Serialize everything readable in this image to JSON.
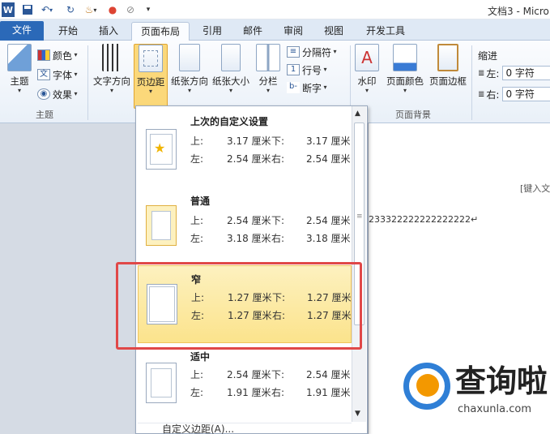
{
  "window": {
    "title": "文档3 - Micro"
  },
  "quick_access": {
    "icons": [
      "word-logo-icon",
      "save-icon",
      "undo-icon",
      "redo-icon",
      "format-painter-icon",
      "color-icon",
      "clear-format-icon",
      "customize-qat-icon"
    ]
  },
  "tabs": [
    {
      "label": "文件"
    },
    {
      "label": "开始"
    },
    {
      "label": "插入"
    },
    {
      "label": "页面布局"
    },
    {
      "label": "引用"
    },
    {
      "label": "邮件"
    },
    {
      "label": "审阅"
    },
    {
      "label": "视图"
    },
    {
      "label": "开发工具"
    }
  ],
  "ribbon": {
    "theme_group": {
      "label": "主题",
      "themes_btn": "主题",
      "colors_btn": "颜色",
      "fonts_btn": "字体",
      "effects_btn": "效果"
    },
    "page_setup": {
      "text_direction": "文字方向",
      "margins": "页边距",
      "orientation": "纸张方向",
      "size": "纸张大小",
      "columns": "分栏",
      "breaks": "分隔符",
      "line_numbers": "行号",
      "hyphenation": "断字"
    },
    "page_background": {
      "label": "页面背景",
      "watermark": "水印",
      "page_color": "页面颜色",
      "page_borders": "页面边框"
    },
    "indent": {
      "label": "缩进",
      "left_label": "左:",
      "left_value": "0 字符",
      "right_label": "右:",
      "right_value": "0 字符"
    }
  },
  "margins_menu": {
    "items": [
      {
        "name": "上次的自定义设置",
        "top_label": "上:",
        "top": "3.17 厘米",
        "bottom_label": "下:",
        "bottom": "3.17 厘米",
        "left_label": "左:",
        "left": "2.54 厘米",
        "right_label": "右:",
        "right": "2.54 厘米"
      },
      {
        "name": "普通",
        "top_label": "上:",
        "top": "2.54 厘米",
        "bottom_label": "下:",
        "bottom": "2.54 厘米",
        "left_label": "左:",
        "left": "3.18 厘米",
        "right_label": "右:",
        "right": "3.18 厘米"
      },
      {
        "name": "窄",
        "top_label": "上:",
        "top": "1.27 厘米",
        "bottom_label": "下:",
        "bottom": "1.27 厘米",
        "left_label": "左:",
        "left": "1.27 厘米",
        "right_label": "右:",
        "right": "1.27 厘米"
      },
      {
        "name": "适中",
        "top_label": "上:",
        "top": "2.54 厘米",
        "bottom_label": "下:",
        "bottom": "2.54 厘米",
        "left_label": "左:",
        "left": "1.91 厘米",
        "right_label": "右:",
        "right": "1.91 厘米"
      }
    ],
    "footer": "自定义边距(A)..."
  },
  "document": {
    "header_hint": "[键入文",
    "body_text": "233322222222222222↵"
  },
  "watermark": {
    "name": "查询啦",
    "url": "chaxunla.com"
  },
  "colors": {
    "file_tab": "#2b69b8",
    "selected_item": "#fbe38c",
    "highlight_box": "#e04848",
    "watermark_blue": "#2f7fd6",
    "watermark_orange": "#f39800"
  }
}
